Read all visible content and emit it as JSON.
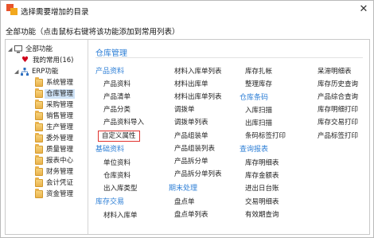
{
  "window": {
    "title": "选择需要增加的目录",
    "close_glyph": "✕"
  },
  "hint": "全部功能（点击鼠标右键将该功能添加到常用列表）",
  "tree": {
    "root": "全部功能",
    "favorites": "我的常用(16)",
    "erp": "ERP功能",
    "items": [
      "系统管理",
      "仓库管理",
      "采购管理",
      "销售管理",
      "生产管理",
      "委外管理",
      "质量管理",
      "报表中心",
      "财务管理",
      "会计凭证",
      "资金管理"
    ],
    "selected_index": 1
  },
  "content": {
    "section": "仓库管理",
    "col1": {
      "g1": "产品资料",
      "g1_items": [
        "产品资料",
        "产品清单",
        "产品分类",
        "产品资料导入",
        "自定义属性"
      ],
      "g2": "基础资料",
      "g2_items": [
        "单位资料",
        "仓库资料",
        "出入库类型"
      ],
      "g3": "库存交易",
      "g3_items": [
        "材料入库单"
      ]
    },
    "col2": {
      "items": [
        "材料入库单列表",
        "材料出库单",
        "材料出库单列表",
        "调拨单",
        "调拨单列表",
        "产品组装单",
        "产品组装列表",
        "产品拆分单",
        "产品拆分单列表"
      ],
      "g1": "期末处理",
      "g1_items": [
        "盘点单",
        "盘点单列表"
      ]
    },
    "col3": {
      "items": [
        "库存扎帐",
        "整理库存"
      ],
      "g1": "仓库条码",
      "g1_items": [
        "入库扫描",
        "出库扫描",
        "条码标签打印"
      ],
      "g2": "查询报表",
      "g2_items": [
        "库存明细表",
        "库存金额表",
        "进出日台账",
        "交易明细表",
        "有效期查询"
      ]
    },
    "col4": {
      "items": [
        "呆滞明细表",
        "库存历史查询",
        "产品综合查询",
        "库存明细打印",
        "库存交易打印",
        "产品标签打印"
      ]
    }
  }
}
